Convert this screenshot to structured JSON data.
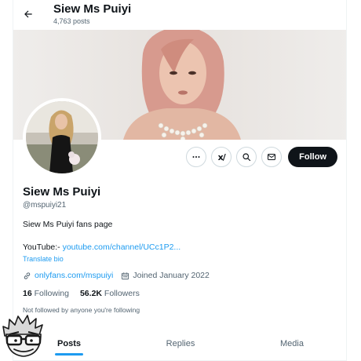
{
  "header": {
    "title": "Siew Ms Puiyi",
    "posts_count": "4,763 posts"
  },
  "profile": {
    "name": "Siew Ms Puiyi",
    "handle": "@mspuiyi21",
    "bio": "Siew Ms Puiyi fans page",
    "bio_link_prefix": "YouTube:- ",
    "bio_link": "youtube.com/channel/UCc1P2...",
    "translate_label": "Translate bio",
    "website": "onlyfans.com/mspuiyi",
    "joined": "Joined January 2022",
    "following_count": "16",
    "following_label": "Following",
    "followers_count": "56.2K",
    "followers_label": "Followers",
    "followed_by": "Not followed by anyone you're following"
  },
  "actions": {
    "follow_label": "Follow",
    "grok_glyph": "x/"
  },
  "tabs": [
    {
      "label": "Posts",
      "active": true
    },
    {
      "label": "Replies",
      "active": false
    },
    {
      "label": "Media",
      "active": false
    }
  ],
  "colors": {
    "accent": "#1d9bf0",
    "text": "#0f1419",
    "muted": "#536471",
    "follow_bg": "#0f1419"
  },
  "icons": {
    "back": "arrow-left-icon",
    "more": "more-icon",
    "grok": "grok-icon",
    "search": "search-icon",
    "message": "envelope-icon",
    "link": "link-icon",
    "calendar": "calendar-icon"
  }
}
